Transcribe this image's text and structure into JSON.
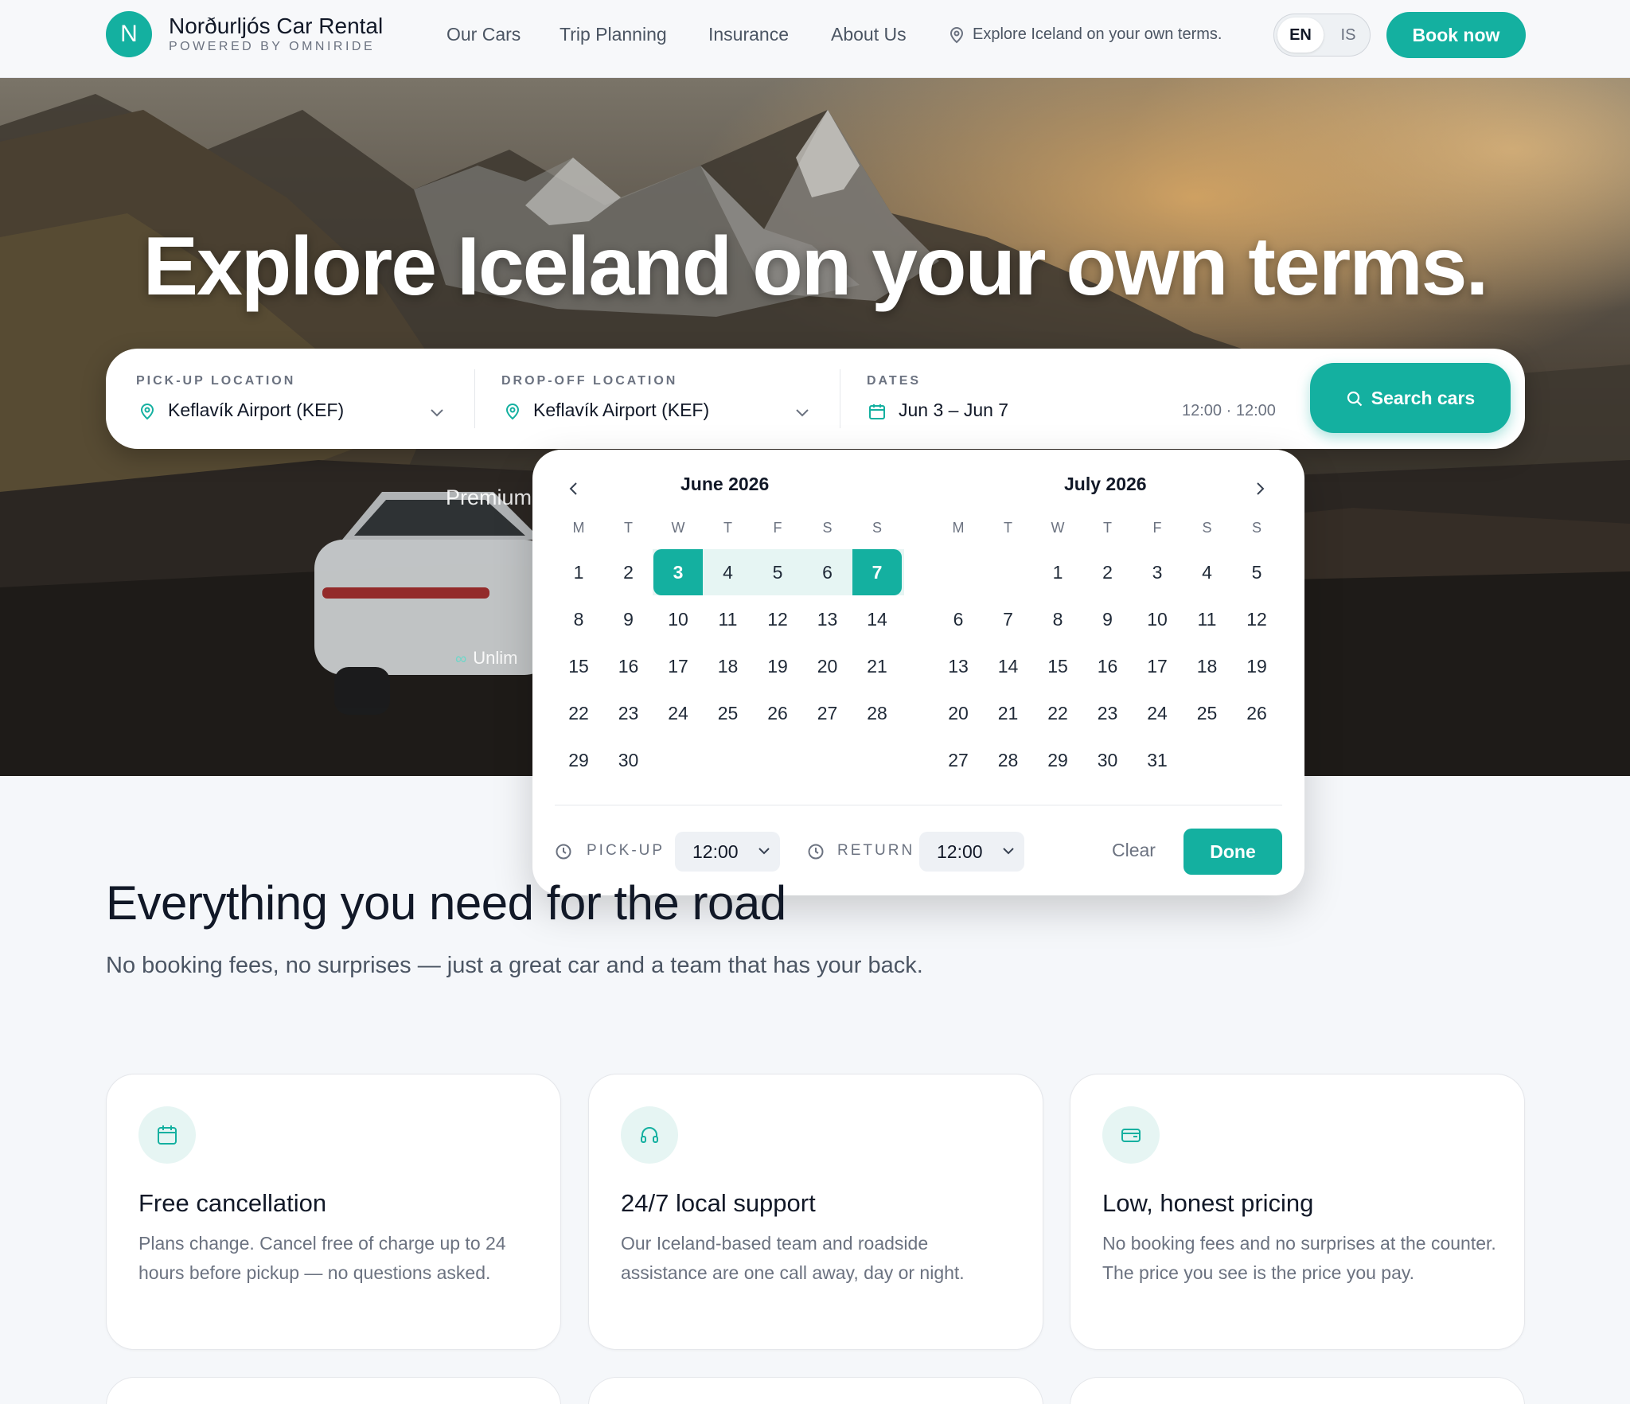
{
  "header": {
    "logo_letter": "N",
    "brand_name": "Norðurljós Car Rental",
    "brand_sub": "POWERED BY OMNIRIDE",
    "nav": [
      "Our Cars",
      "Trip Planning",
      "Insurance",
      "About Us"
    ],
    "tagline": "Explore Iceland on your own terms.",
    "lang_en": "EN",
    "lang_is": "IS",
    "book_label": "Book now"
  },
  "hero": {
    "title": "Explore Iceland on your own terms.",
    "premium_text": "Premium",
    "unlimited_text": "Unlim"
  },
  "search": {
    "pickup_label": "PICK-UP LOCATION",
    "pickup_value": "Keflavík Airport (KEF)",
    "dropoff_label": "DROP-OFF LOCATION",
    "dropoff_value": "Keflavík Airport (KEF)",
    "dates_label": "DATES",
    "dates_value": "Jun 3 – Jun 7",
    "times_value": "12:00 · 12:00",
    "search_label": "Search cars"
  },
  "picker": {
    "months": [
      {
        "title": "June 2026",
        "offset": 0,
        "days": 30
      },
      {
        "title": "July 2026",
        "offset": 2,
        "days": 31
      }
    ],
    "weekdays": [
      "M",
      "T",
      "W",
      "T",
      "F",
      "S",
      "S"
    ],
    "selected_start": 3,
    "selected_end": 7,
    "pickup_label": "PICK-UP",
    "pickup_time": "12:00",
    "return_label": "RETURN",
    "return_time": "12:00",
    "clear_label": "Clear",
    "done_label": "Done"
  },
  "features": {
    "title": "Everything you need for the road",
    "subtitle": "No booking fees, no surprises — just a great car and a team that has your back.",
    "cards": [
      {
        "icon": "calendar-icon",
        "title": "Free cancellation",
        "text": "Plans change. Cancel free of charge up to 24 hours before pickup — no questions asked."
      },
      {
        "icon": "headset-icon",
        "title": "24/7 local support",
        "text": "Our Iceland-based team and roadside assistance are one call away, day or night."
      },
      {
        "icon": "wallet-icon",
        "title": "Low, honest pricing",
        "text": "No booking fees and no surprises at the counter. The price you see is the price you pay."
      }
    ]
  },
  "colors": {
    "accent": "#14b0a0",
    "accent_light": "#e6f5f3",
    "text_dark": "#111827",
    "text_muted": "#6b7280"
  }
}
